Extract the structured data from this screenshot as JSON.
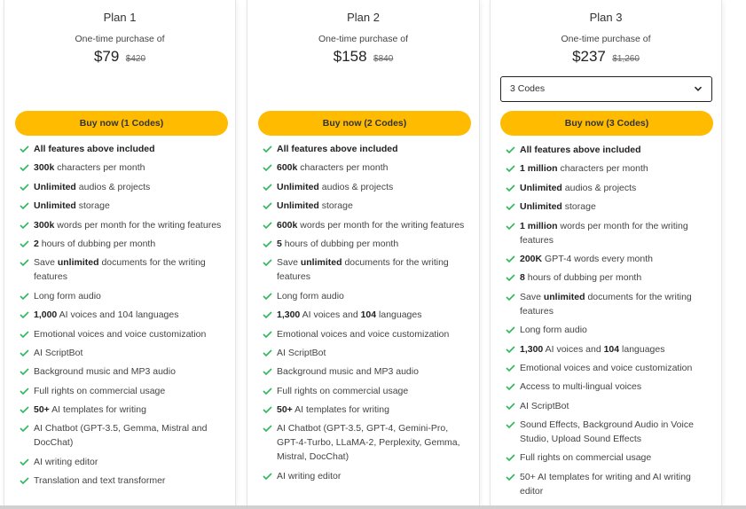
{
  "colors": {
    "accent": "#ffbb00",
    "check": "#2eb85c"
  },
  "plans": [
    {
      "title": "Plan 1",
      "subtitle": "One-time purchase of",
      "price": "$79",
      "old_price": "$420",
      "buy_label": "Buy now (1 Codes)",
      "features": [
        {
          "bold": "All features above included",
          "rest": ""
        },
        {
          "bold": "300k",
          "rest": " characters per month"
        },
        {
          "bold": "Unlimited",
          "rest": " audios & projects"
        },
        {
          "bold": "Unlimited",
          "rest": " storage"
        },
        {
          "bold": "300k",
          "rest": " words per month for the writing features"
        },
        {
          "bold": "2",
          "rest": " hours of dubbing per month"
        },
        {
          "pre": "Save ",
          "bold": "unlimited",
          "rest": " documents for the writing features"
        },
        {
          "bold": "",
          "rest": "Long form audio"
        },
        {
          "bold": "1,000",
          "rest": " AI voices and 104 languages"
        },
        {
          "bold": "",
          "rest": "Emotional voices and voice customization"
        },
        {
          "bold": "",
          "rest": "AI ScriptBot"
        },
        {
          "bold": "",
          "rest": "Background music and MP3 audio"
        },
        {
          "bold": "",
          "rest": "Full rights on commercial usage"
        },
        {
          "bold": "50+",
          "rest": " AI templates for writing"
        },
        {
          "bold": "",
          "rest": "AI Chatbot (GPT-3.5, Gemma, Mistral and DocChat)"
        },
        {
          "bold": "",
          "rest": "AI writing editor"
        },
        {
          "bold": "",
          "rest": "Translation and text transformer"
        }
      ]
    },
    {
      "title": "Plan 2",
      "subtitle": "One-time purchase of",
      "price": "$158",
      "old_price": "$840",
      "buy_label": "Buy now (2 Codes)",
      "features": [
        {
          "bold": "All features above included",
          "rest": ""
        },
        {
          "bold": "600k",
          "rest": " characters per month"
        },
        {
          "bold": "Unlimited",
          "rest": " audios & projects"
        },
        {
          "bold": "Unlimited",
          "rest": " storage"
        },
        {
          "bold": "600k",
          "rest": " words per month for the writing features"
        },
        {
          "bold": "5",
          "rest": " hours of dubbing per month"
        },
        {
          "pre": "Save ",
          "bold": "unlimited",
          "rest": " documents for the writing features"
        },
        {
          "bold": "",
          "rest": "Long form audio"
        },
        {
          "bold": "1,300",
          "rest": " AI voices and ",
          "bold2": "104",
          "rest2": " languages"
        },
        {
          "bold": "",
          "rest": "Emotional voices and voice customization"
        },
        {
          "bold": "",
          "rest": "AI ScriptBot"
        },
        {
          "bold": "",
          "rest": "Background music and MP3 audio"
        },
        {
          "bold": "",
          "rest": "Full rights on commercial usage"
        },
        {
          "bold": "50+",
          "rest": " AI templates for writing"
        },
        {
          "bold": "",
          "rest": "AI Chatbot (GPT-3.5, GPT-4, Gemini-Pro, GPT-4-Turbo, LLaMA-2, Perplexity, Gemma, Mistral, DocChat)"
        },
        {
          "bold": "",
          "rest": "AI writing editor"
        }
      ]
    },
    {
      "title": "Plan 3",
      "subtitle": "One-time purchase of",
      "price": "$237",
      "old_price": "$1,260",
      "select_value": "3 Codes",
      "buy_label": "Buy now (3 Codes)",
      "features": [
        {
          "bold": "All features above included",
          "rest": ""
        },
        {
          "bold": "1 million",
          "rest": " characters per month"
        },
        {
          "bold": "Unlimited",
          "rest": " audios & projects"
        },
        {
          "bold": "Unlimited",
          "rest": " storage"
        },
        {
          "bold": "1 million",
          "rest": " words per month for the writing features"
        },
        {
          "bold": "200K",
          "rest": " GPT-4 words every month"
        },
        {
          "bold": "8",
          "rest": " hours of dubbing per month"
        },
        {
          "pre": "Save ",
          "bold": "unlimited",
          "rest": " documents for the writing features"
        },
        {
          "bold": "",
          "rest": "Long form audio"
        },
        {
          "bold": "1,300",
          "rest": " AI voices and ",
          "bold2": "104",
          "rest2": " languages"
        },
        {
          "bold": "",
          "rest": "Emotional voices and voice customization"
        },
        {
          "bold": "",
          "rest": "Access to multi-lingual voices"
        },
        {
          "bold": "",
          "rest": "AI ScriptBot"
        },
        {
          "bold": "",
          "rest": "Sound Effects, Background Audio in Voice Studio, Upload Sound Effects"
        },
        {
          "bold": "",
          "rest": "Full rights on commercial usage"
        },
        {
          "bold": "",
          "rest": "50+ AI templates for writing and AI writing editor"
        }
      ]
    }
  ]
}
